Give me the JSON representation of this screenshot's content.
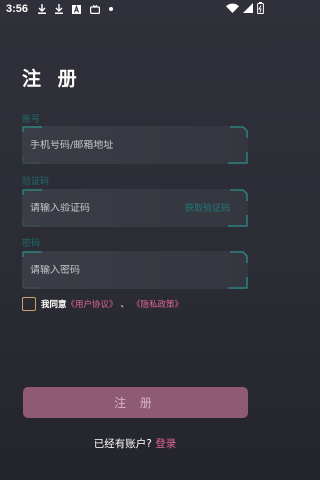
{
  "status_bar": {
    "time": "3:56",
    "notification_icons": [
      "download-icon",
      "download-icon",
      "font-icon",
      "tv-icon",
      "dot-icon"
    ],
    "system_icons": [
      "wifi-icon",
      "signal-icon",
      "battery-icon"
    ]
  },
  "page": {
    "title": "注 册"
  },
  "account": {
    "label": "账号",
    "placeholder": "手机号码/邮箱地址"
  },
  "code": {
    "label": "验证码",
    "placeholder": "请输入验证码",
    "get_code_label": "获取验证码"
  },
  "password": {
    "label": "密码",
    "placeholder": "请输入密码"
  },
  "agreement": {
    "prefix": "我同意",
    "user_agreement": "《用户协议》",
    "separator": "、",
    "privacy_policy": "《隐私政策》"
  },
  "submit": {
    "label": "注 册"
  },
  "footer": {
    "prompt": "已经有账户? ",
    "login_link": "登录"
  },
  "colors": {
    "accent_teal": "#1f6d6d",
    "link_pink": "#e0679b",
    "button_bg": "#8e5a74",
    "checkbox_border": "#c9a468"
  }
}
